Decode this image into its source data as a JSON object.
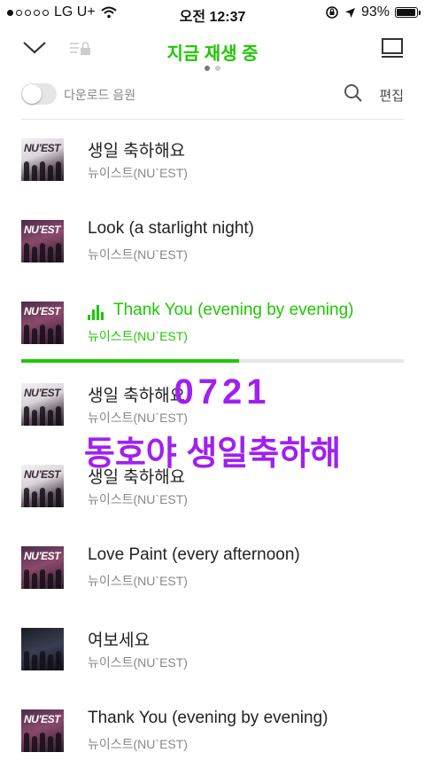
{
  "status_bar": {
    "carrier": "LG U+",
    "time": "오전 12:37",
    "battery": "93%",
    "battery_level": 0.93
  },
  "header": {
    "title": "지금 재생 중",
    "pages": 2,
    "current_page": 0
  },
  "toolbar": {
    "download_label": "다운로드 음원",
    "edit_label": "편집",
    "download_toggle_on": false
  },
  "tracks": [
    {
      "title": "생일 축하해요",
      "artist": "뉴이스트(NU`EST)",
      "cover": "A"
    },
    {
      "title": "Look (a starlight night)",
      "artist": "뉴이스트(NU`EST)",
      "cover": "B"
    },
    {
      "title": "Thank You (evening by evening)",
      "artist": "뉴이스트(NU`EST)",
      "cover": "B",
      "playing": true
    },
    {
      "title": "생일 축하해요",
      "artist": "뉴이스트(NU`EST)",
      "cover": "A"
    },
    {
      "title": "생일 축하해요",
      "artist": "뉴이스트(NU`EST)",
      "cover": "A"
    },
    {
      "title": "Love Paint (every afternoon)",
      "artist": "뉴이스트(NU`EST)",
      "cover": "B"
    },
    {
      "title": "여보세요",
      "artist": "뉴이스트(NU`EST)",
      "cover": "C"
    },
    {
      "title": "Thank You (evening by evening)",
      "artist": "뉴이스트(NU`EST)",
      "cover": "B"
    }
  ],
  "playback": {
    "progress": 0.57
  },
  "overlay": {
    "line1": "0721",
    "line2": "동호야 생일축하해"
  },
  "colors": {
    "accent": "#1ec800",
    "overlay_text": "#a020f0"
  }
}
